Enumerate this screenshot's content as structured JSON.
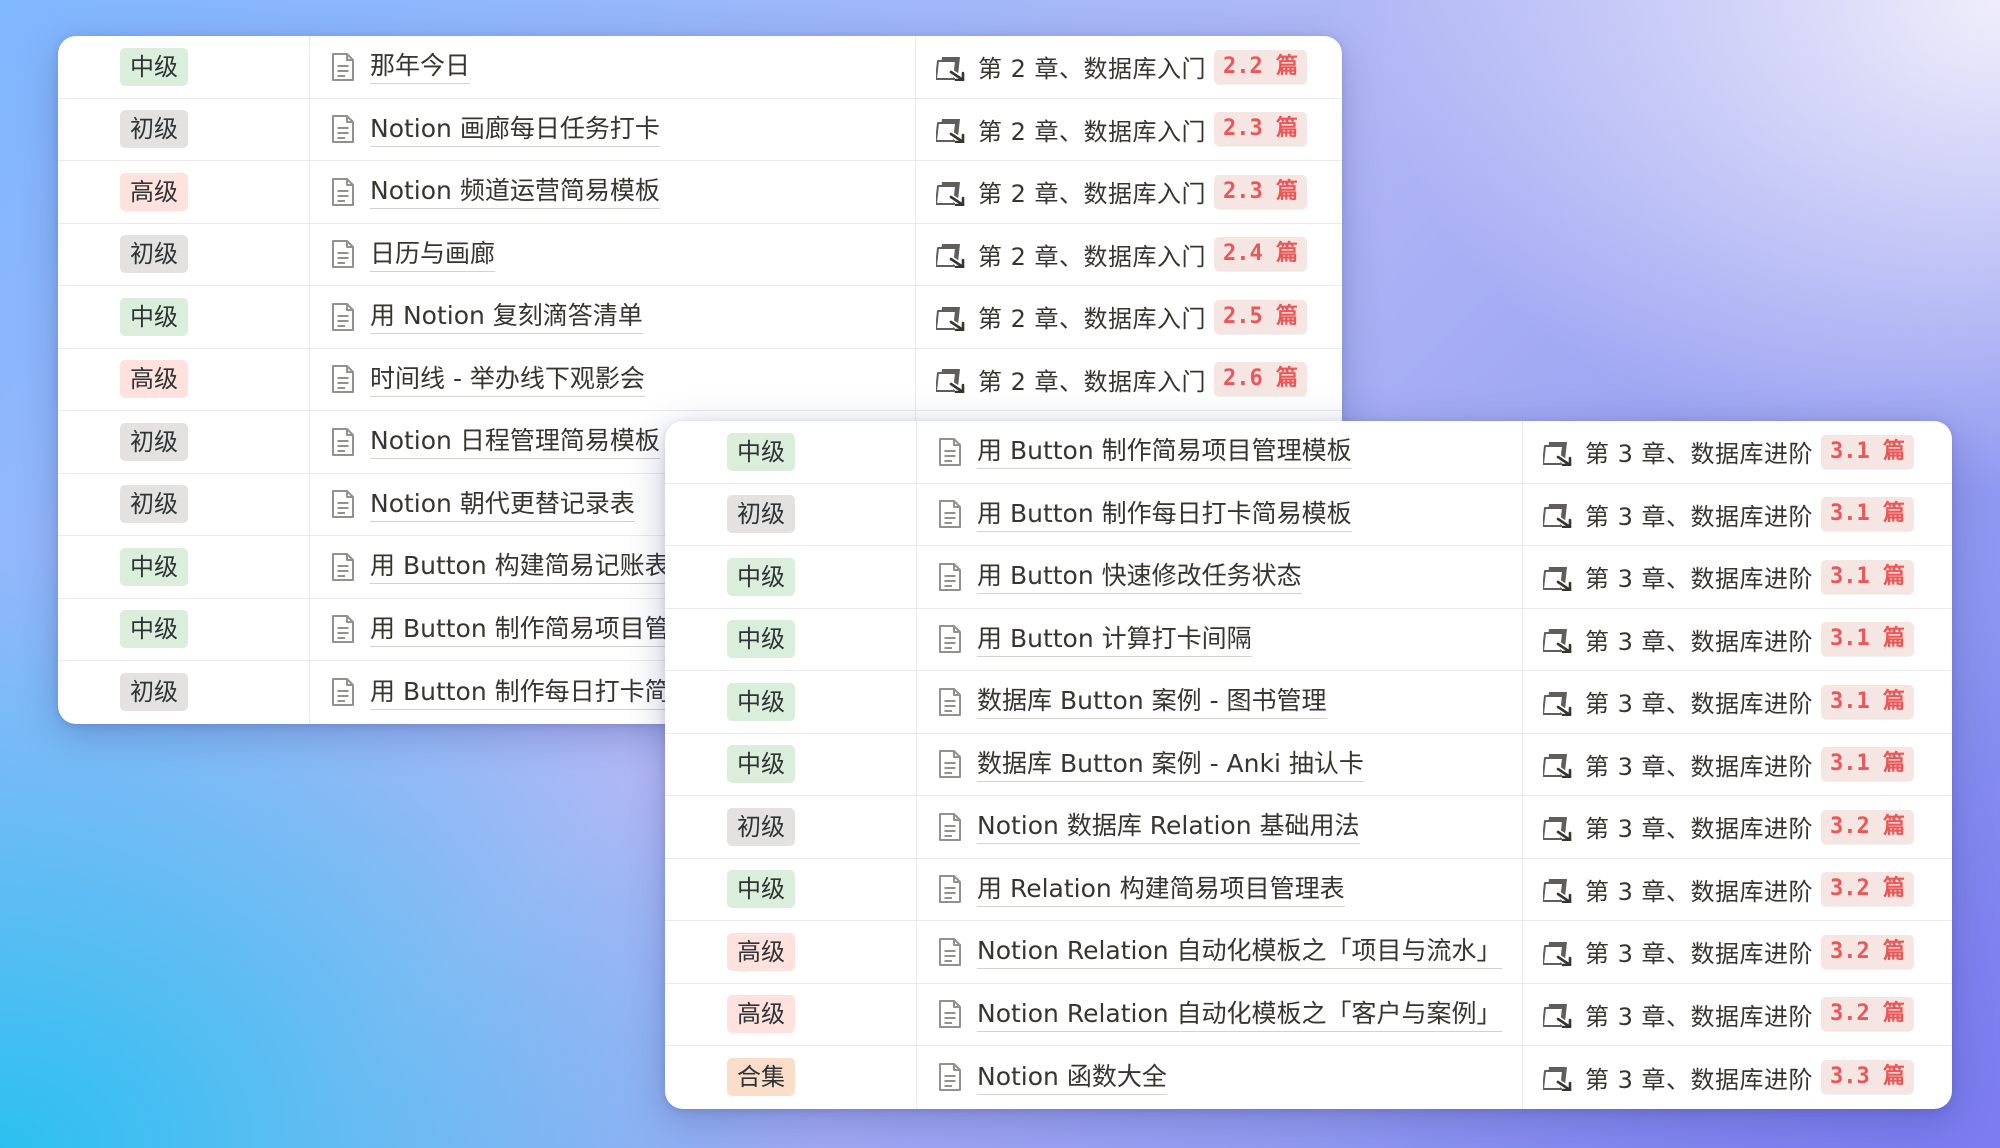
{
  "colors": {
    "level_green": "#dbeddb",
    "level_gray": "#e3e2e0",
    "level_red": "#ffe2dd",
    "level_orange": "#fadec9",
    "tag_text": "#eb5757",
    "tag_bg": "#f5e5e3"
  },
  "icons": {
    "page": "document-icon",
    "relation": "relation-link-icon"
  },
  "table_a": {
    "rows": [
      {
        "level": "中级",
        "color": "green",
        "title": "那年今日",
        "chapter": "第 2 章、数据库入门",
        "tag": "2.2 篇"
      },
      {
        "level": "初级",
        "color": "gray",
        "title": "Notion 画廊每日任务打卡",
        "chapter": "第 2 章、数据库入门",
        "tag": "2.3 篇"
      },
      {
        "level": "高级",
        "color": "red",
        "title": "Notion 频道运营简易模板",
        "chapter": "第 2 章、数据库入门",
        "tag": "2.3 篇"
      },
      {
        "level": "初级",
        "color": "gray",
        "title": "日历与画廊",
        "chapter": "第 2 章、数据库入门",
        "tag": "2.4 篇"
      },
      {
        "level": "中级",
        "color": "green",
        "title": "用 Notion 复刻滴答清单",
        "chapter": "第 2 章、数据库入门",
        "tag": "2.5 篇"
      },
      {
        "level": "高级",
        "color": "red",
        "title": "时间线 - 举办线下观影会",
        "chapter": "第 2 章、数据库入门",
        "tag": "2.6 篇"
      },
      {
        "level": "初级",
        "color": "gray",
        "title": "Notion 日程管理简易模板",
        "chapter": "",
        "tag": ""
      },
      {
        "level": "初级",
        "color": "gray",
        "title": "Notion 朝代更替记录表",
        "chapter": "",
        "tag": ""
      },
      {
        "level": "中级",
        "color": "green",
        "title": "用 Button 构建简易记账表",
        "chapter": "",
        "tag": ""
      },
      {
        "level": "中级",
        "color": "green",
        "title": "用 Button 制作简易项目管理模板",
        "chapter": "",
        "tag": ""
      },
      {
        "level": "初级",
        "color": "gray",
        "title": "用 Button 制作每日打卡简易模板",
        "chapter": "",
        "tag": ""
      }
    ]
  },
  "table_b": {
    "rows": [
      {
        "level": "中级",
        "color": "green",
        "title": "用 Button 制作简易项目管理模板",
        "chapter": "第 3 章、数据库进阶",
        "tag": "3.1 篇"
      },
      {
        "level": "初级",
        "color": "gray",
        "title": "用 Button 制作每日打卡简易模板",
        "chapter": "第 3 章、数据库进阶",
        "tag": "3.1 篇"
      },
      {
        "level": "中级",
        "color": "green",
        "title": "用 Button 快速修改任务状态",
        "chapter": "第 3 章、数据库进阶",
        "tag": "3.1 篇"
      },
      {
        "level": "中级",
        "color": "green",
        "title": "用 Button 计算打卡间隔",
        "chapter": "第 3 章、数据库进阶",
        "tag": "3.1 篇"
      },
      {
        "level": "中级",
        "color": "green",
        "title": "数据库 Button 案例 - 图书管理",
        "chapter": "第 3 章、数据库进阶",
        "tag": "3.1 篇"
      },
      {
        "level": "中级",
        "color": "green",
        "title": "数据库 Button 案例 - Anki 抽认卡",
        "chapter": "第 3 章、数据库进阶",
        "tag": "3.1 篇"
      },
      {
        "level": "初级",
        "color": "gray",
        "title": "Notion 数据库 Relation 基础用法",
        "chapter": "第 3 章、数据库进阶",
        "tag": "3.2 篇"
      },
      {
        "level": "中级",
        "color": "green",
        "title": "用 Relation 构建简易项目管理表",
        "chapter": "第 3 章、数据库进阶",
        "tag": "3.2 篇"
      },
      {
        "level": "高级",
        "color": "red",
        "title": "Notion Relation 自动化模板之「项目与流水」",
        "chapter": "第 3 章、数据库进阶",
        "tag": "3.2 篇"
      },
      {
        "level": "高级",
        "color": "red",
        "title": "Notion Relation 自动化模板之「客户与案例」",
        "chapter": "第 3 章、数据库进阶",
        "tag": "3.2 篇"
      },
      {
        "level": "合集",
        "color": "orange",
        "title": "Notion 函数大全",
        "chapter": "第 3 章、数据库进阶",
        "tag": "3.3 篇"
      }
    ]
  }
}
